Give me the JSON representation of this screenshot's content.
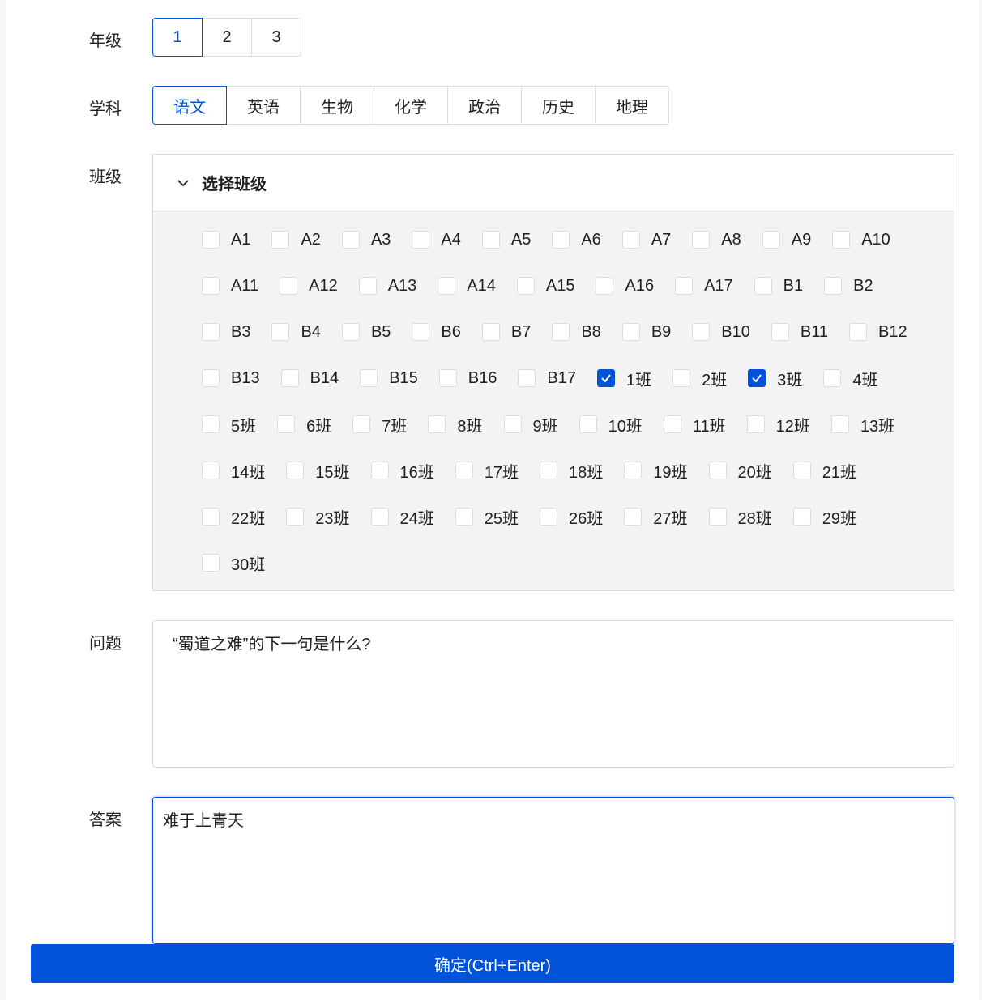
{
  "grade": {
    "label": "年级",
    "options": [
      "1",
      "2",
      "3"
    ],
    "selected": "1"
  },
  "subject": {
    "label": "学科",
    "options": [
      "语文",
      "英语",
      "生物",
      "化学",
      "政治",
      "历史",
      "地理"
    ],
    "selected": "语文"
  },
  "classes": {
    "label": "班级",
    "panel_title": "选择班级",
    "rows": [
      [
        "A1",
        "A2",
        "A3",
        "A4",
        "A5",
        "A6",
        "A7",
        "A8",
        "A9",
        "A10"
      ],
      [
        "A11",
        "A12",
        "A13",
        "A14",
        "A15",
        "A16",
        "A17",
        "B1",
        "B2"
      ],
      [
        "B3",
        "B4",
        "B5",
        "B6",
        "B7",
        "B8",
        "B9",
        "B10",
        "B11",
        "B12"
      ],
      [
        "B13",
        "B14",
        "B15",
        "B16",
        "B17",
        "1班",
        "2班",
        "3班",
        "4班"
      ],
      [
        "5班",
        "6班",
        "7班",
        "8班",
        "9班",
        "10班",
        "11班",
        "12班",
        "13班"
      ],
      [
        "14班",
        "15班",
        "16班",
        "17班",
        "18班",
        "19班",
        "20班",
        "21班"
      ],
      [
        "22班",
        "23班",
        "24班",
        "25班",
        "26班",
        "27班",
        "28班",
        "29班"
      ],
      [
        "30班"
      ]
    ],
    "checked": [
      "1班",
      "3班"
    ]
  },
  "question": {
    "label": "问题",
    "value": "“蜀道之难”的下一句是什么?"
  },
  "answer": {
    "label": "答案",
    "value": "难于上青天"
  },
  "submit_label": "确定(Ctrl+Enter)",
  "colors": {
    "accent": "#0052d9"
  }
}
